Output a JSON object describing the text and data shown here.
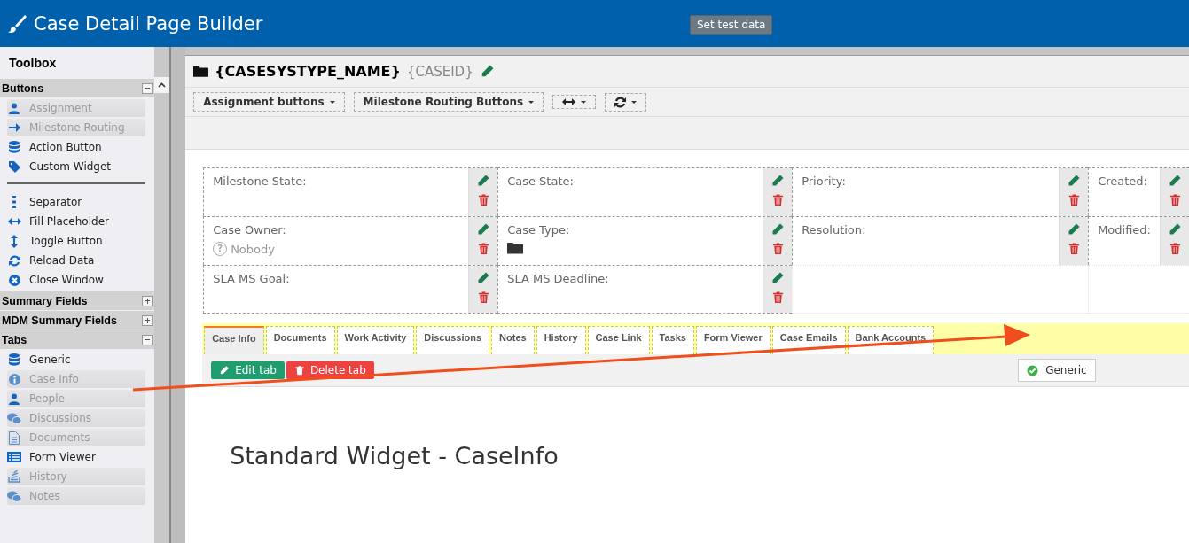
{
  "header": {
    "title": "Case Detail Page Builder",
    "test_button": "Set test data"
  },
  "toolbox": {
    "title": "Toolbox",
    "sections": [
      {
        "title": "Buttons",
        "expanded": true,
        "items": [
          {
            "label": "Assignment",
            "kind": "user",
            "disabled": true
          },
          {
            "label": "Milestone Routing",
            "kind": "arrow",
            "disabled": true
          },
          {
            "label": "Action Button",
            "kind": "database",
            "disabled": false
          },
          {
            "label": "Custom Widget",
            "kind": "tag",
            "disabled": false
          },
          {
            "kind": "divider"
          },
          {
            "label": "Separator",
            "kind": "dots",
            "disabled": false
          },
          {
            "label": "Fill Placeholder",
            "kind": "harrow",
            "disabled": false
          },
          {
            "label": "Toggle Button",
            "kind": "varrow",
            "disabled": false
          },
          {
            "label": "Reload Data",
            "kind": "refresh",
            "disabled": false
          },
          {
            "label": "Close Window",
            "kind": "close",
            "disabled": false
          }
        ]
      },
      {
        "title": "Summary Fields",
        "expanded": false
      },
      {
        "title": "MDM Summary Fields",
        "expanded": false
      },
      {
        "title": "Tabs",
        "expanded": true,
        "items": [
          {
            "label": "Generic",
            "kind": "database",
            "disabled": false
          },
          {
            "label": "Case Info",
            "kind": "info",
            "disabled": true
          },
          {
            "label": "People",
            "kind": "user",
            "disabled": true
          },
          {
            "label": "Discussions",
            "kind": "chat",
            "disabled": true
          },
          {
            "label": "Documents",
            "kind": "document",
            "disabled": true
          },
          {
            "label": "Form Viewer",
            "kind": "list",
            "disabled": false
          },
          {
            "label": "History",
            "kind": "stack",
            "disabled": true
          },
          {
            "label": "Notes",
            "kind": "chat",
            "disabled": true
          }
        ]
      }
    ]
  },
  "case": {
    "type_name": "{CASESYSTYPE_NAME}",
    "case_id": "{CASEID}"
  },
  "toolbar": [
    {
      "kind": "dropdown",
      "label": "Assignment buttons"
    },
    {
      "kind": "dropdown",
      "label": "Milestone Routing Buttons"
    },
    {
      "kind": "hresize"
    },
    {
      "kind": "refresh"
    }
  ],
  "summary_rows": [
    [
      {
        "label": "Milestone State:"
      },
      {
        "label": "Case State:"
      },
      {
        "label": "Priority:"
      },
      {
        "label": "Created:"
      }
    ],
    [
      {
        "label": "Case Owner:",
        "value": {
          "kind": "unknown",
          "icon": "?",
          "text": "Nobody"
        }
      },
      {
        "label": "Case Type:",
        "value": {
          "kind": "folder"
        }
      },
      {
        "label": "Resolution:"
      },
      {
        "label": "Modified:"
      }
    ],
    [
      {
        "label": "SLA MS Goal:"
      },
      {
        "label": "SLA MS Deadline:"
      }
    ]
  ],
  "tabs": [
    {
      "label": "Case Info",
      "selected": true
    },
    {
      "label": "Documents",
      "selected": false
    },
    {
      "label": "Work Activity",
      "selected": false
    },
    {
      "label": "Discussions",
      "selected": false
    },
    {
      "label": "Notes",
      "selected": false
    },
    {
      "label": "History",
      "selected": false
    },
    {
      "label": "Case Link",
      "selected": false
    },
    {
      "label": "Tasks",
      "selected": false
    },
    {
      "label": "Form Viewer",
      "selected": false
    },
    {
      "label": "Case Emails",
      "selected": false
    },
    {
      "label": "Bank Accounts",
      "selected": false
    }
  ],
  "tab_actions": {
    "edit": "Edit tab",
    "delete": "Delete tab",
    "widget_type": "Generic"
  },
  "content": {
    "heading": "Standard Widget - CaseInfo"
  }
}
